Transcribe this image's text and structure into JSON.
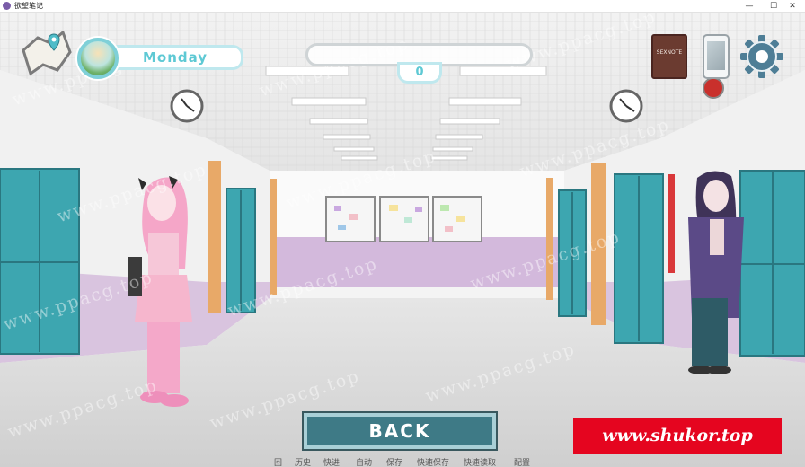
{
  "window": {
    "title": "欲望笔记",
    "controls": {
      "minimize": "—",
      "maximize": "☐",
      "close": "✕"
    }
  },
  "hud": {
    "map_icon": "map-icon",
    "day_label": "Monday",
    "counter": "0",
    "notebook_label": "SEXNOTE",
    "phone_icon": "phone-icon",
    "settings_icon": "gear-icon"
  },
  "back_button": "BACK",
  "quick_menu": [
    "回",
    "历史",
    "快进",
    "自动",
    "保存",
    "快速保存",
    "快速读取",
    "配置"
  ],
  "promo_banner": "www.shukor.top",
  "watermark": "www.ppacg.top",
  "colors": {
    "accent": "#5ec9d4",
    "back_button": "#3e7a86",
    "promo": "#e5051f"
  }
}
